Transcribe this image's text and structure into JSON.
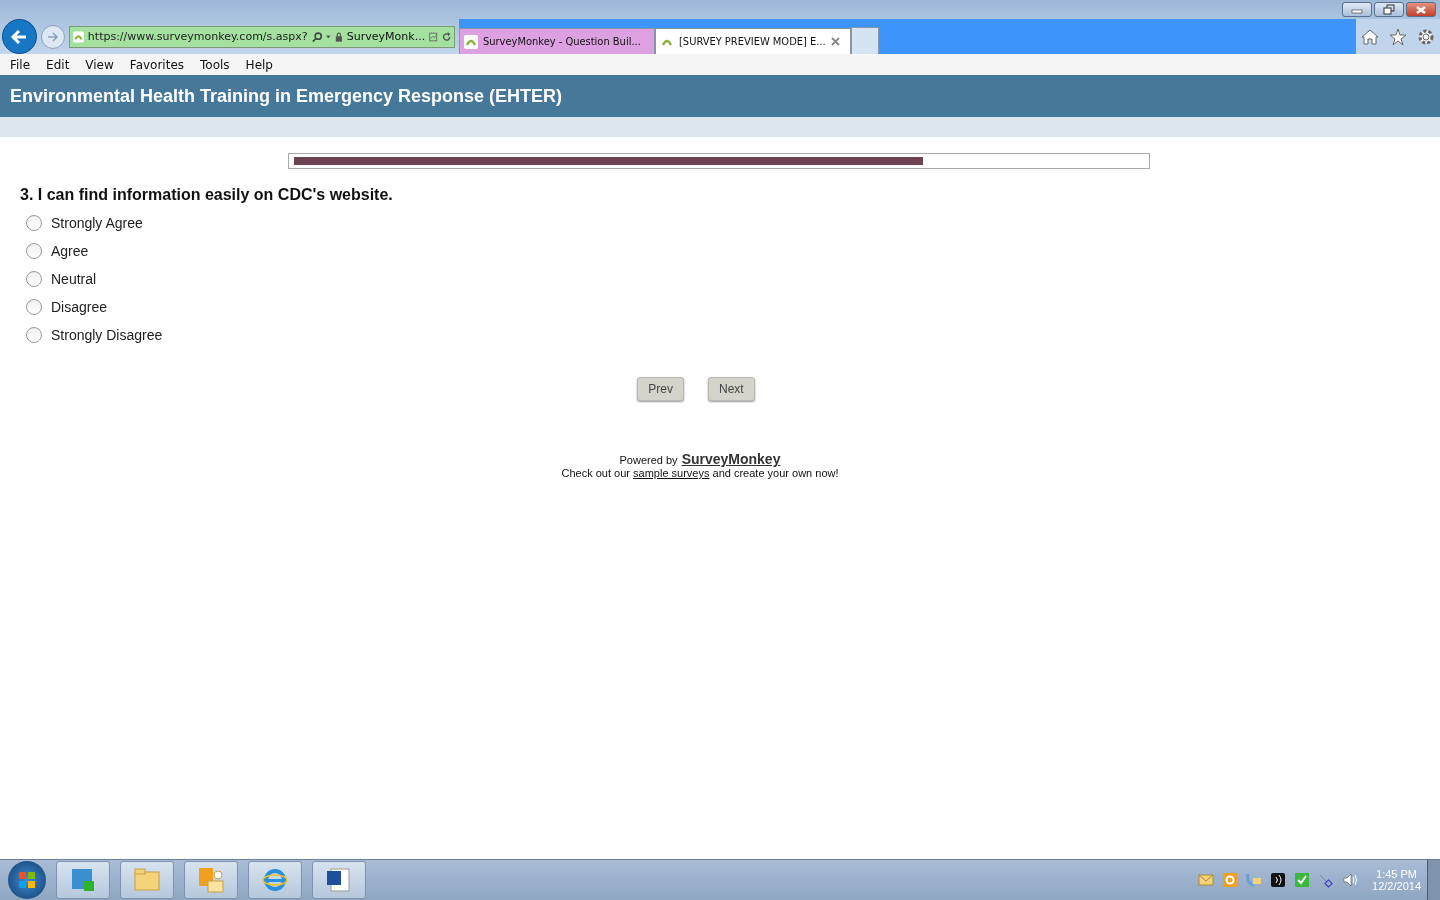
{
  "browser": {
    "address": "https://www.surveymonkey.com/s.aspx?",
    "site_identity": "SurveyMonk...",
    "tabs": [
      {
        "label": "SurveyMonkey - Question Buil...",
        "selected": false
      },
      {
        "label": "[SURVEY PREVIEW MODE] E...",
        "selected": true
      }
    ],
    "menu": [
      "File",
      "Edit",
      "View",
      "Favorites",
      "Tools",
      "Help"
    ]
  },
  "survey": {
    "title": "Environmental Health Training in Emergency Response (EHTER)",
    "progress": {
      "level": 0.74
    },
    "question": "3. I can find information easily on CDC's website.",
    "options": [
      {
        "label": "Strongly Agree",
        "selected": false
      },
      {
        "label": "Agree",
        "selected": false
      },
      {
        "label": "Neutral",
        "selected": false
      },
      {
        "label": "Disagree",
        "selected": false
      },
      {
        "label": "Strongly Disagree",
        "selected": false
      }
    ],
    "buttons": [
      "Prev",
      "Next"
    ],
    "footer": {
      "powered_by": "Powered by",
      "brand": "SurveyMonkey",
      "text_before": "Check out our",
      "link": "sample surveys",
      "text_after": "and create your own now!"
    }
  },
  "taskbar": {
    "time": "1:45 PM",
    "date": "12/2/2014"
  }
}
